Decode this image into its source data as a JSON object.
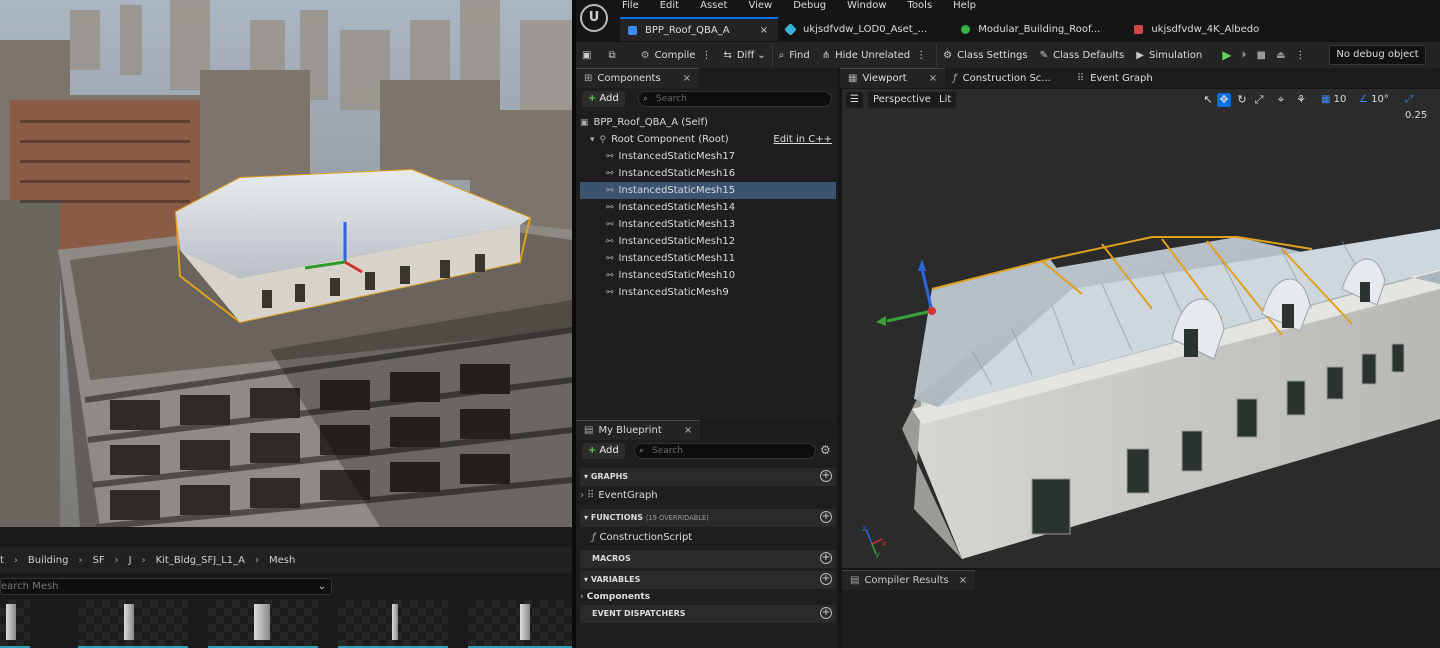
{
  "menu": [
    "File",
    "Edit",
    "Asset",
    "View",
    "Debug",
    "Window",
    "Tools",
    "Help"
  ],
  "doc_tabs": [
    {
      "label": "BPP_Roof_QBA_A",
      "color": "#3d8bff",
      "active": true,
      "close": "×"
    },
    {
      "label": "ukjsdfvdw_LOD0_Aset_...",
      "color": "#39b3d4",
      "active": false
    },
    {
      "label": "Modular_Building_Roof...",
      "color": "#39b349",
      "active": false
    },
    {
      "label": "ukjsdfvdw_4K_Albedo",
      "color": "#d44848",
      "active": false
    }
  ],
  "toolbar": {
    "compile": "Compile",
    "diff": "Diff",
    "find": "Find",
    "hide_unrelated": "Hide Unrelated",
    "class_settings": "Class Settings",
    "class_defaults": "Class Defaults",
    "simulation": "Simulation",
    "debug_object": "No debug object"
  },
  "components": {
    "tab": "Components",
    "add": "Add",
    "search_placeholder": "Search",
    "self": "BPP_Roof_QBA_A (Self)",
    "root": "Root Component (Root)",
    "edit_cpp": "Edit in C++",
    "items": [
      "InstancedStaticMesh17",
      "InstancedStaticMesh16",
      "InstancedStaticMesh15",
      "InstancedStaticMesh14",
      "InstancedStaticMesh13",
      "InstancedStaticMesh12",
      "InstancedStaticMesh11",
      "InstancedStaticMesh10",
      "InstancedStaticMesh9"
    ],
    "selected_index": 2
  },
  "my_blueprint": {
    "tab": "My Blueprint",
    "add": "Add",
    "search_placeholder": "Search",
    "graphs": "GRAPHS",
    "event_graph": "EventGraph",
    "functions": "FUNCTIONS",
    "functions_note": "(19 OVERRIDABLE)",
    "construction_script": "ConstructionScript",
    "macros": "MACROS",
    "variables": "VARIABLES",
    "components": "Components",
    "event_dispatchers": "EVENT DISPATCHERS"
  },
  "viewport_tabs": {
    "viewport": "Viewport",
    "construction": "Construction Sc...",
    "event_graph": "Event Graph"
  },
  "viewport": {
    "perspective": "Perspective",
    "lit": "Lit",
    "grid": "10",
    "angle": "10°",
    "scale": "0.25"
  },
  "compiler": {
    "tab": "Compiler Results"
  },
  "content_browser": {
    "path": [
      "t",
      "Building",
      "SF",
      "J",
      "Kit_Bldg_SFJ_L1_A",
      "Mesh"
    ],
    "search_placeholder": "earch Mesh"
  },
  "colors": {
    "accent": "#0070e0",
    "selection": "#3b536f",
    "play": "#5fd15f"
  }
}
